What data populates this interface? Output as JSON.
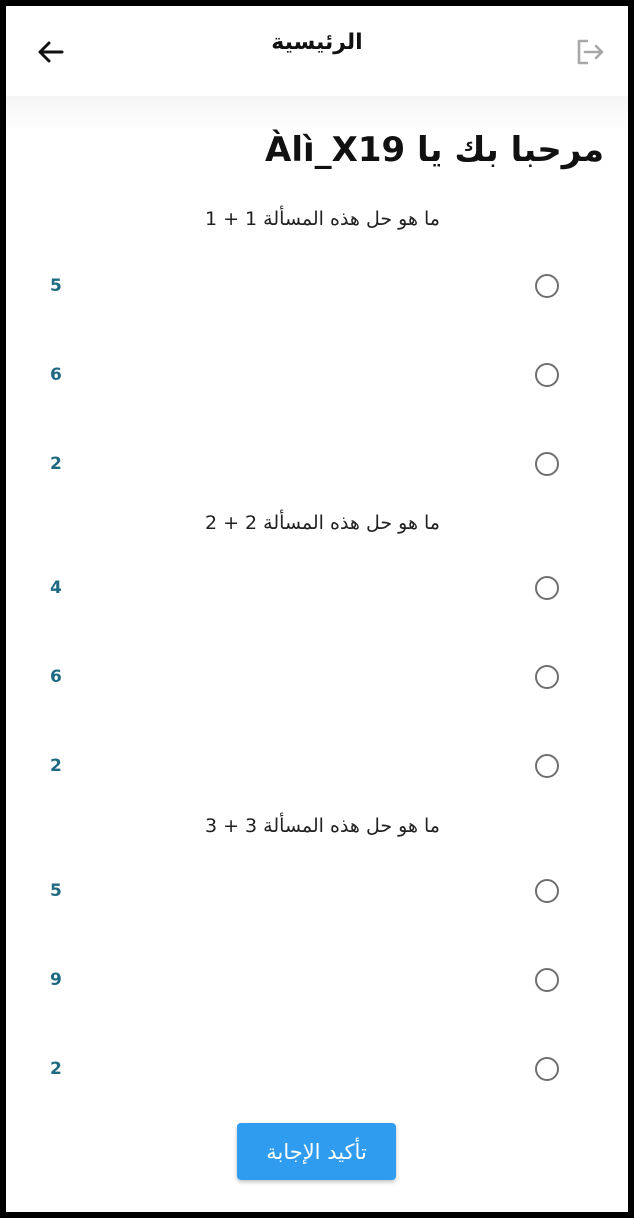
{
  "appbar": {
    "title": "الرئيسية",
    "back_icon": "arrow-left-icon",
    "logout_icon": "logout-icon"
  },
  "greeting": "مرحبا بك  يا Àlì_X19",
  "questions": [
    {
      "text": "ما هو حل هذه المسألة 1 + 1",
      "options": [
        "5",
        "6",
        "2"
      ]
    },
    {
      "text": "ما هو حل هذه المسألة 2 + 2",
      "options": [
        "4",
        "6",
        "2"
      ]
    },
    {
      "text": "ما هو حل هذه المسألة 3 + 3",
      "options": [
        "5",
        "9",
        "2"
      ]
    }
  ],
  "confirm_label": "تأكيد الإجابة",
  "colors": {
    "accent": "#2f9cf0",
    "option_text": "#1f6a83",
    "radio_border": "#6f6f6f"
  }
}
